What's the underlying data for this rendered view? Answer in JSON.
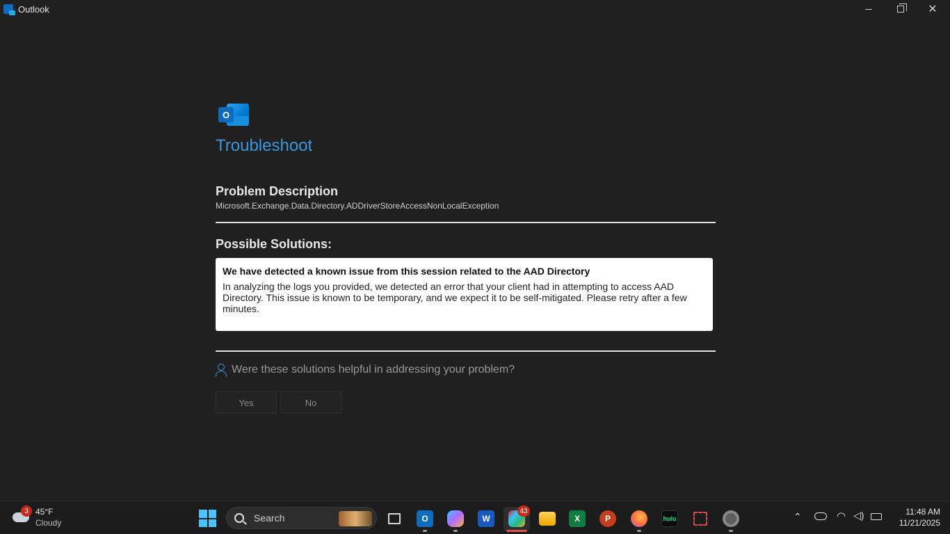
{
  "window": {
    "title": "Outlook"
  },
  "troubleshoot": {
    "title": "Troubleshoot",
    "problem_heading": "Problem Description",
    "problem_text": "Microsoft.Exchange.Data.Directory.ADDriverStoreAccessNonLocalException",
    "solutions_heading": "Possible Solutions:",
    "solution_title": "We have detected a known issue from this session related to the AAD Directory",
    "solution_body": "In analyzing the logs you provided, we detected an error that your client had in attempting to access AAD Directory. This issue is known to be temporary, and we expect it to be self-mitigated. Please retry after a few minutes.",
    "feedback_question": "Were these solutions helpful in addressing your problem?",
    "yes_label": "Yes",
    "no_label": "No"
  },
  "taskbar": {
    "weather": {
      "temp": "45°F",
      "condition": "Cloudy",
      "badge": "3"
    },
    "search_label": "Search",
    "slack_badge": "43",
    "apps": [
      "task-view",
      "outlook",
      "copilot",
      "word",
      "slack",
      "file-explorer",
      "excel",
      "powerpoint",
      "firefox",
      "hulu",
      "snipping-tool",
      "settings"
    ],
    "clock": {
      "time": "11:48 AM",
      "date": "11/21/2025"
    }
  },
  "colors": {
    "accent": "#3a96dd",
    "background": "#202020",
    "taskbar": "#1c1c1c"
  }
}
